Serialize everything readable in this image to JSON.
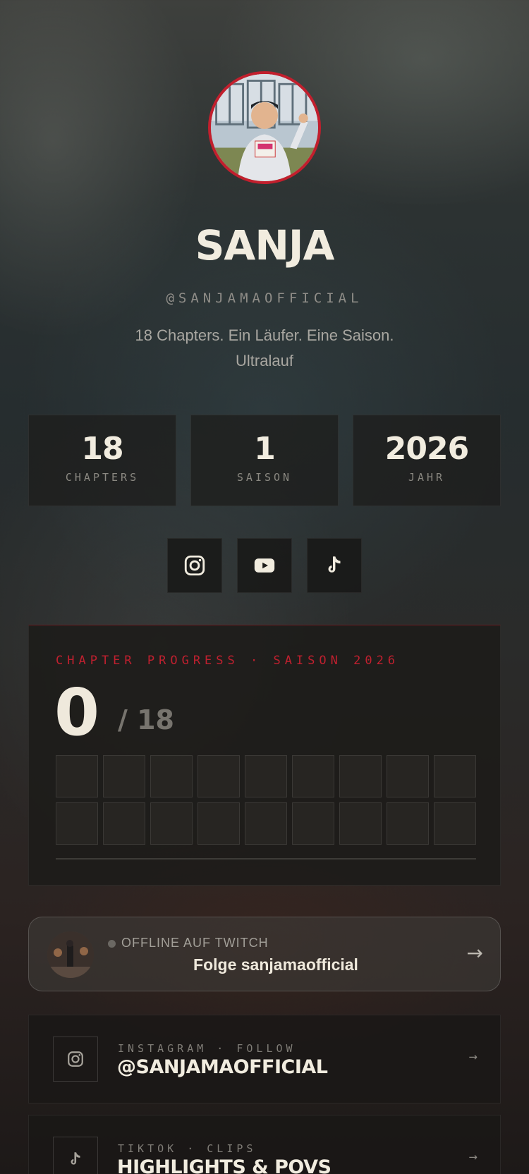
{
  "profile": {
    "name": "SANJA",
    "handle": "@SANJAMAOFFICIAL",
    "bio_line1": "18 Chapters. Ein Läufer. Eine Saison.",
    "bio_line2": "Ultralauf"
  },
  "stats": [
    {
      "value": "18",
      "label": "CHAPTERS"
    },
    {
      "value": "1",
      "label": "SAISON"
    },
    {
      "value": "2026",
      "label": "JAHR"
    }
  ],
  "socials": [
    {
      "icon": "instagram-icon"
    },
    {
      "icon": "youtube-icon"
    },
    {
      "icon": "tiktok-icon"
    }
  ],
  "progress": {
    "caption": "CHAPTER PROGRESS · SAISON 2026",
    "current": "0",
    "total": "/ 18",
    "completed_fraction": 0
  },
  "twitch": {
    "status": "OFFLINE AUF TWITCH",
    "cta": "Folge sanjamaofficial",
    "arrow": "→"
  },
  "links": [
    {
      "kicker": "INSTAGRAM · FOLLOW",
      "title": "@SANJAMAOFFICIAL",
      "icon": "instagram-icon",
      "arrow": "→"
    },
    {
      "kicker": "TIKTOK · CLIPS",
      "title": "HIGHLIGHTS & POVS",
      "icon": "tiktok-icon",
      "arrow": "→"
    }
  ],
  "colors": {
    "accent": "#c21f2d",
    "text": "#efe9dc",
    "muted": "#8a8881"
  }
}
